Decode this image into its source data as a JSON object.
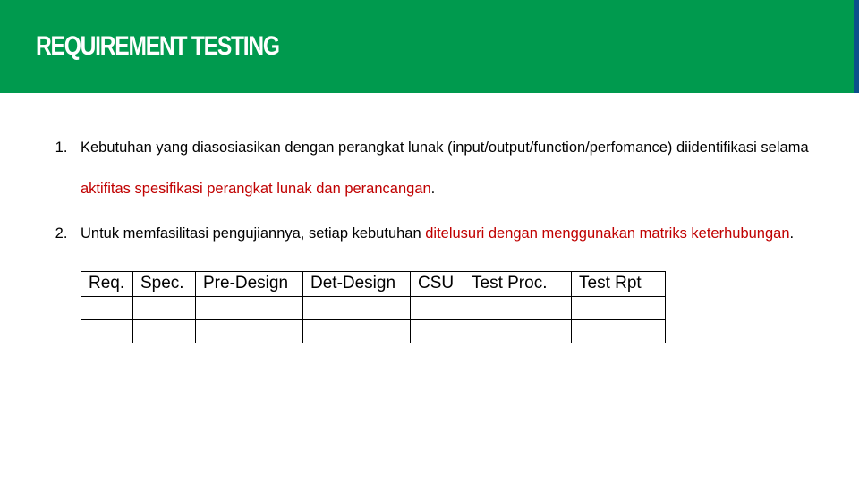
{
  "header": {
    "title": "REQUIREMENT TESTING"
  },
  "points": {
    "item1": {
      "lead": "Kebutuhan yang diasosiasikan dengan perangkat lunak (input/output/function/perfomance) diidentifikasi selama ",
      "emph": "aktifitas spesifikasi perangkat lunak dan perancangan",
      "tail": "."
    },
    "item2": {
      "lead": "Untuk memfasilitasi pengujiannya, setiap kebutuhan ",
      "emph": "ditelusuri dengan menggunakan matriks keterhubungan",
      "tail": "."
    }
  },
  "table": {
    "headers": [
      "Req.",
      "Spec.",
      "Pre-Design",
      "Det-Design",
      "CSU",
      "Test Proc.",
      "Test Rpt"
    ],
    "rows": [
      [
        "",
        "",
        "",
        "",
        "",
        "",
        ""
      ],
      [
        "",
        "",
        "",
        "",
        "",
        "",
        ""
      ]
    ]
  }
}
